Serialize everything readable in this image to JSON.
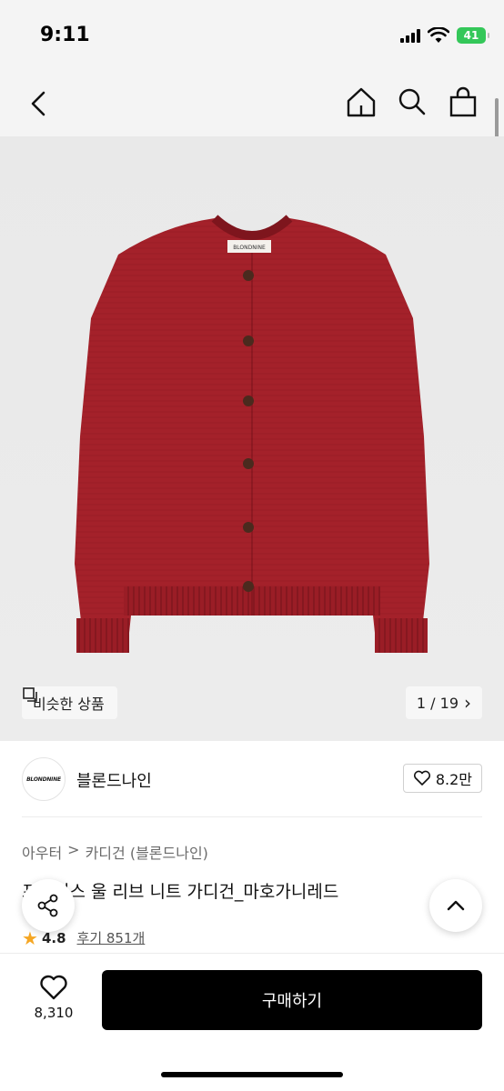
{
  "status": {
    "time": "9:11",
    "battery": "41"
  },
  "nav": {
    "icons": [
      "chevron-left-icon",
      "home-icon",
      "search-icon",
      "shopping-bag-icon"
    ]
  },
  "image": {
    "garment_label": "BLONDNINE",
    "similar_label": "비슷한 상품",
    "pager": "1 / 19",
    "pager_arrow": "›"
  },
  "brand": {
    "logo_text": "BLONDNINE",
    "name": "블론드나인",
    "likes": "8.2만"
  },
  "breadcrumb": {
    "category": "아우터",
    "separator": ">",
    "subcategory": "카디건 (블론드나인)"
  },
  "product": {
    "title": "프레이스 울 리브 니트 가디건_마호가니레드",
    "rating": "4.8",
    "reviews": "후기 851개"
  },
  "bottom": {
    "wish_count": "8,310",
    "buy_label": "구매하기"
  },
  "colors": {
    "accent": "#000000",
    "star": "#f5a623",
    "garment": "#a4212a",
    "battery": "#34c759"
  }
}
